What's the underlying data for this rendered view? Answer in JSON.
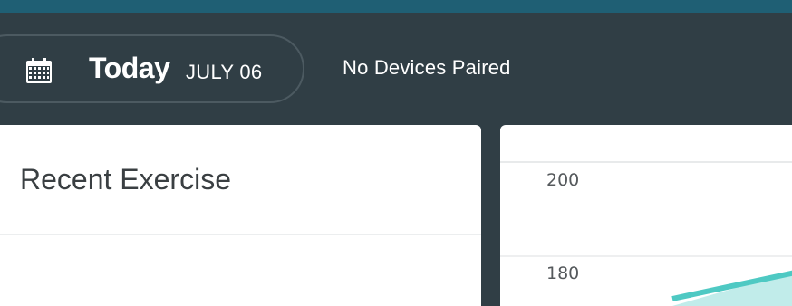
{
  "header": {
    "today_label": "Today",
    "date": "JULY 06",
    "devices_status": "No Devices Paired"
  },
  "recent_exercise": {
    "title": "Recent Exercise"
  },
  "chart_data": {
    "type": "line",
    "yticks": [
      200,
      180
    ],
    "series_color": "#4ec9c3"
  }
}
